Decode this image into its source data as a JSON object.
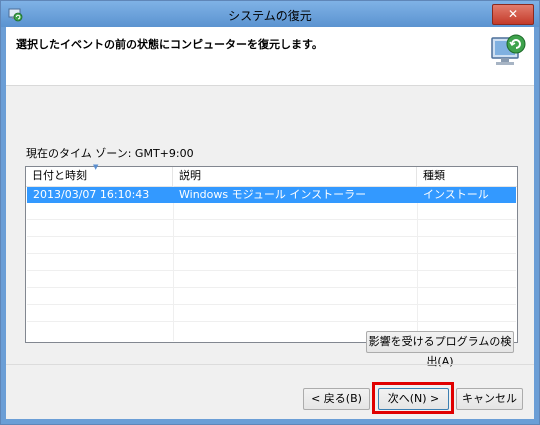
{
  "window": {
    "title": "システムの復元",
    "close_label": "✕"
  },
  "header": {
    "heading": "選択したイベントの前の状態にコンピューターを復元します。"
  },
  "timezone_label": "現在のタイム ゾーン: GMT+9:00",
  "table": {
    "columns": [
      "日付と時刻",
      "説明",
      "種類"
    ],
    "rows": [
      {
        "datetime": "2013/03/07 16:10:43",
        "description": "Windows モジュール インストーラー",
        "type": "インストール",
        "selected": true
      }
    ]
  },
  "buttons": {
    "scan": "影響を受けるプログラムの検出(A)",
    "back": "< 戻る(B)",
    "next": "次へ(N) >",
    "cancel": "キャンセル"
  },
  "colors": {
    "selection": "#3399ff",
    "highlight_box": "#e00000",
    "titlebar": "#6b9ed6",
    "close_button": "#c43b2a"
  },
  "icons": {
    "app": "system-restore-icon",
    "banner": "computer-restore-icon"
  }
}
